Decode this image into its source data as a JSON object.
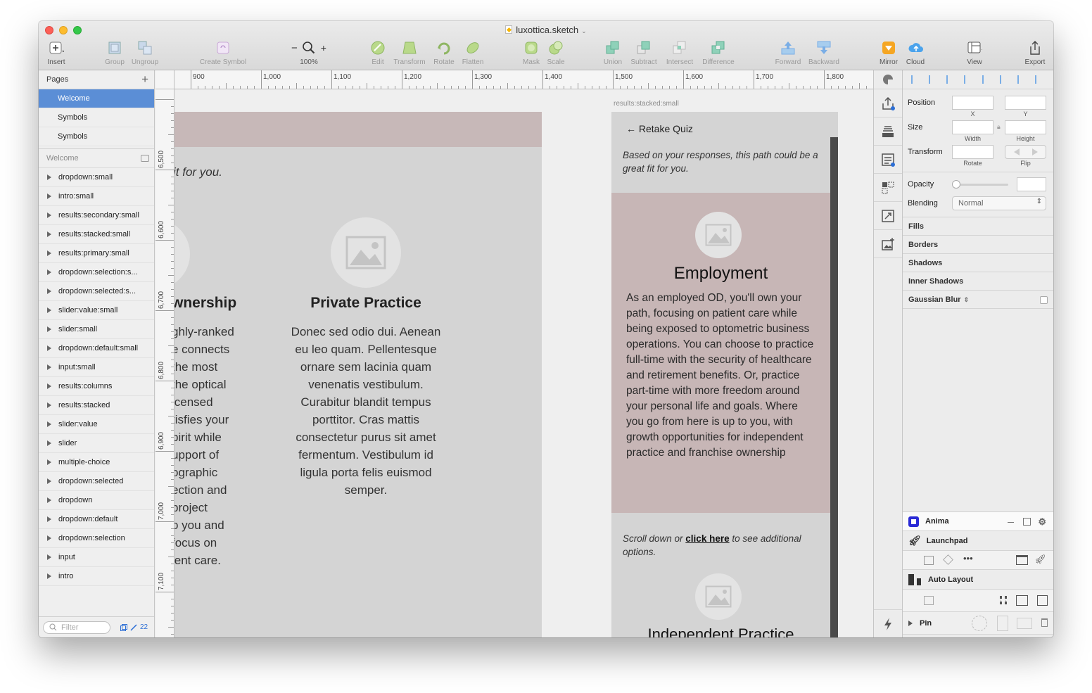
{
  "window": {
    "title": "luxottica.sketch"
  },
  "toolbar": {
    "insert": "Insert",
    "group": "Group",
    "ungroup": "Ungroup",
    "create_symbol": "Create Symbol",
    "zoom_minus": "−",
    "zoom_plus": "+",
    "zoom": "100%",
    "edit": "Edit",
    "transform": "Transform",
    "rotate": "Rotate",
    "flatten": "Flatten",
    "mask": "Mask",
    "scale": "Scale",
    "union": "Union",
    "subtract": "Subtract",
    "intersect": "Intersect",
    "difference": "Difference",
    "forward": "Forward",
    "backward": "Backward",
    "mirror": "Mirror",
    "cloud": "Cloud",
    "view": "View",
    "export": "Export"
  },
  "sidebar": {
    "pages_title": "Pages",
    "pages": [
      {
        "label": "Welcome",
        "selected": true
      },
      {
        "label": "Symbols"
      },
      {
        "label": "Symbols"
      }
    ],
    "layers_title": "Welcome",
    "layers": [
      "dropdown:small",
      "intro:small",
      "results:secondary:small",
      "results:stacked:small",
      "results:primary:small",
      "dropdown:selection:s...",
      "dropdown:selected:s...",
      "slider:value:small",
      "slider:small",
      "dropdown:default:small",
      "input:small",
      "results:columns",
      "results:stacked",
      "slider:value",
      "slider",
      "multiple-choice",
      "dropdown:selected",
      "dropdown",
      "dropdown:default",
      "dropdown:selection",
      "input",
      "intro"
    ],
    "filter_placeholder": "Filter",
    "count": "22"
  },
  "rulers": {
    "top": [
      "900",
      "1,000",
      "1,100",
      "1,200",
      "1,300",
      "1,400",
      "1,500",
      "1,600",
      "1,700",
      "1,800"
    ],
    "left": [
      "6,500",
      "6,600",
      "6,700",
      "6,800",
      "6,900",
      "7,000",
      "7,100"
    ]
  },
  "artboard_a": {
    "intro_fragment": "it for you.",
    "left_heading": "wnership",
    "left_lines": [
      "ghly-ranked",
      "e connects",
      "the most",
      "the optical",
      "icensed",
      "tisfies your",
      "pirit while",
      "upport of",
      "ographic",
      "ection and",
      "project",
      "o you and",
      "focus on",
      "ient care."
    ],
    "right_heading": "Private Practice",
    "right_lines": [
      "Donec sed odio dui. Aenean",
      "eu leo quam. Pellentesque",
      "ornare sem lacinia quam",
      "venenatis vestibulum.",
      "Curabitur blandit tempus",
      "porttitor. Cras mattis",
      "consectetur purus sit amet",
      "fermentum. Vestibulum id",
      "ligula porta felis euismod",
      "semper."
    ]
  },
  "artboard_b": {
    "label": "results:stacked:small",
    "retake": "← Retake Quiz",
    "intro": "Based on your responses, this path could be a great fit for you.",
    "heading": "Employment",
    "body": "As an employed OD, you'll own your path, focusing on patient care while being exposed to optometric business operations. You can choose to practice full-time with the security of healthcare and retirement benefits. Or, practice part-time with more freedom around your personal life and goals. Where you go from here is up to you, with growth opportunities for independent practice and franchise ownership",
    "scroll_before": "Scroll down or ",
    "scroll_link": "click here",
    "scroll_after": " to see additional options.",
    "next_heading": "Independent Practice"
  },
  "inspector": {
    "position": "Position",
    "x": "X",
    "y": "Y",
    "size": "Size",
    "width": "Width",
    "height": "Height",
    "transform": "Transform",
    "rotate": "Rotate",
    "flip": "Flip",
    "opacity": "Opacity",
    "blending": "Blending",
    "blending_value": "Normal",
    "fills": "Fills",
    "borders": "Borders",
    "shadows": "Shadows",
    "inner_shadows": "Inner Shadows",
    "gaussian_blur": "Gaussian Blur"
  },
  "plugins": {
    "anima": "Anima",
    "launchpad": "Launchpad",
    "auto_layout": "Auto Layout",
    "pin": "Pin"
  },
  "colors": {
    "selection": "#5b8ed6",
    "accent_pink": "#c7b6b6",
    "artboard_gray": "#d4d4d4"
  }
}
